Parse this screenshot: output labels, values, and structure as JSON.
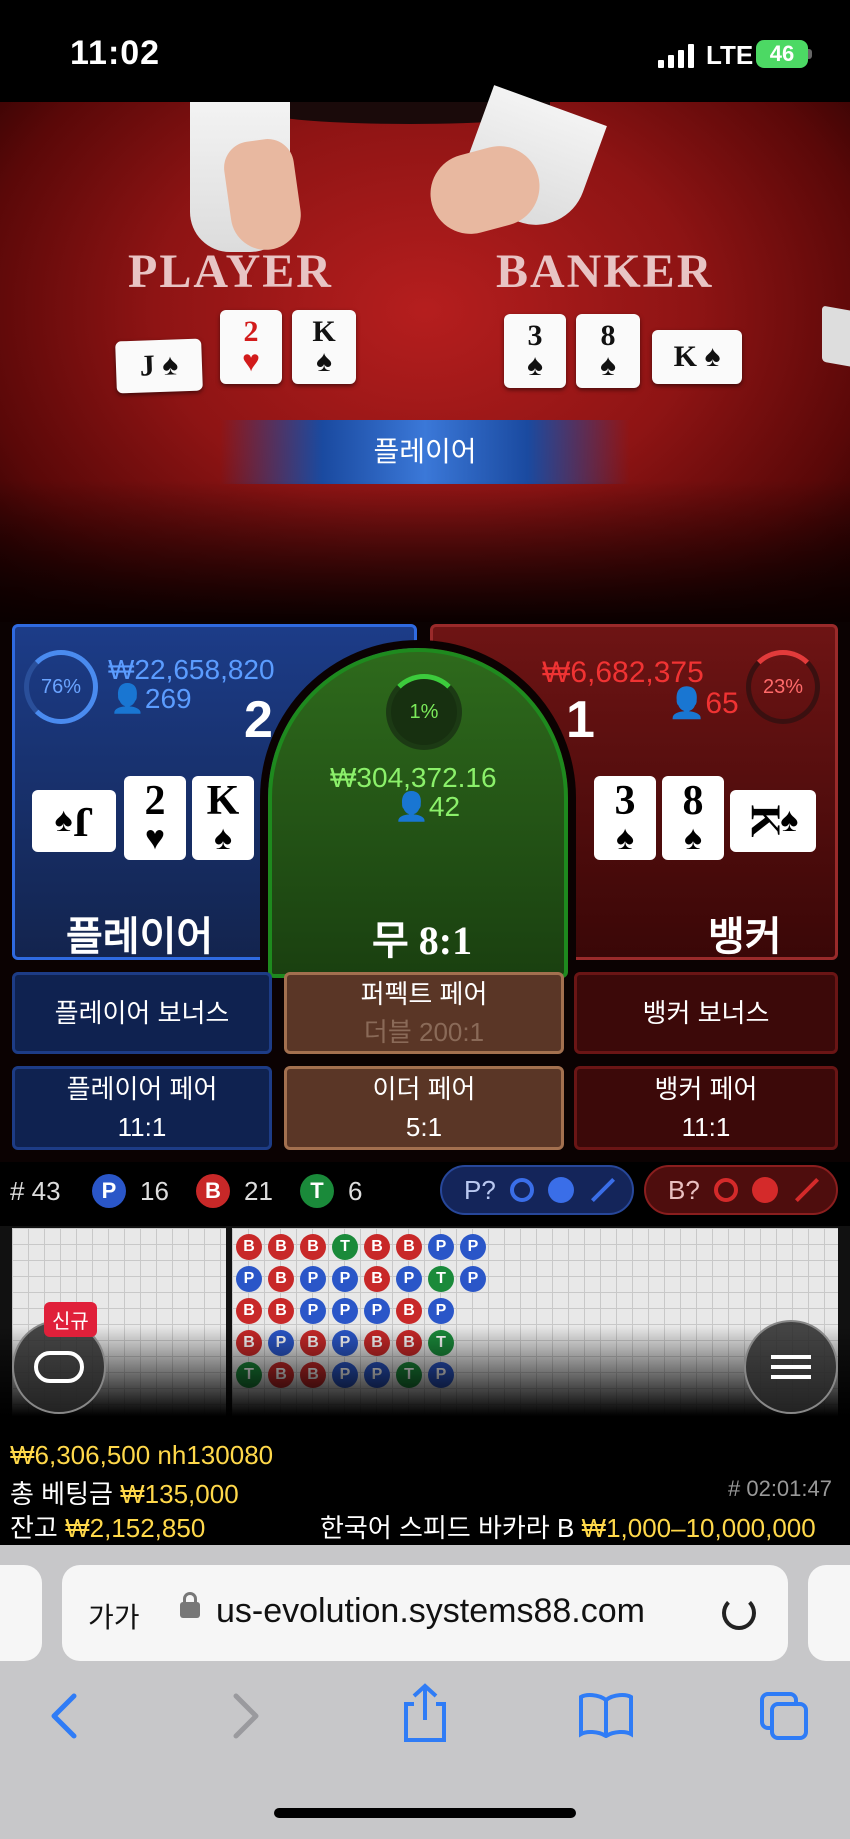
{
  "status_bar": {
    "time": "11:02",
    "network": "LTE",
    "battery": "46"
  },
  "video": {
    "player_label": "PLAYER",
    "banker_label": "BANKER",
    "banner": "플레이어",
    "player_cards": [
      {
        "rank": "J",
        "suit": "♠"
      },
      {
        "rank": "2",
        "suit": "♥"
      },
      {
        "rank": "K",
        "suit": "♠"
      }
    ],
    "banker_cards": [
      {
        "rank": "3",
        "suit": "♠"
      },
      {
        "rank": "8",
        "suit": "♠"
      },
      {
        "rank": "K",
        "suit": "♠"
      }
    ]
  },
  "bets": {
    "player": {
      "percent": "76%",
      "amount": "₩22,658,820",
      "players": "269",
      "score": "2",
      "label": "플레이어",
      "cards": [
        {
          "rank": "J",
          "suit": "♠"
        },
        {
          "rank": "2",
          "suit": "♥"
        },
        {
          "rank": "K",
          "suit": "♠"
        }
      ]
    },
    "tie": {
      "percent": "1%",
      "amount": "₩304,372.16",
      "players": "42",
      "label": "무 8:1"
    },
    "banker": {
      "percent": "23%",
      "amount": "₩6,682,375",
      "players": "65",
      "score": "1",
      "label": "뱅커",
      "cards": [
        {
          "rank": "3",
          "suit": "♠"
        },
        {
          "rank": "8",
          "suit": "♠"
        },
        {
          "rank": "K",
          "suit": "♠"
        }
      ]
    }
  },
  "side_bets": {
    "player_bonus": "플레이어 보너스",
    "perfect_pair": "퍼펙트 페어",
    "perfect_pair_sub": "더블 200:1",
    "banker_bonus": "뱅커 보너스",
    "player_pair": "플레이어 페어",
    "player_pair_odds": "11:1",
    "either_pair": "이더 페어",
    "either_pair_odds": "5:1",
    "banker_pair": "뱅커 페어",
    "banker_pair_odds": "11:1"
  },
  "stats": {
    "round": "# 43",
    "p_letter": "P",
    "p_count": "16",
    "b_letter": "B",
    "b_count": "21",
    "t_letter": "T",
    "t_count": "6",
    "player_predict": "P?",
    "banker_predict": "B?"
  },
  "roads": {
    "new_badge": "신규",
    "columns": [
      [
        "B",
        "P",
        "B",
        "B",
        "T"
      ],
      [
        "B",
        "B",
        "B",
        "P",
        "B"
      ],
      [
        "B",
        "P",
        "P",
        "B",
        "B"
      ],
      [
        "T",
        "P",
        "P",
        "P",
        "P"
      ],
      [
        "B",
        "B",
        "P",
        "B",
        "P"
      ],
      [
        "B",
        "P",
        "B",
        "B",
        "T"
      ],
      [
        "P",
        "T",
        "P",
        "T",
        "P"
      ],
      [
        "P",
        "P",
        "",
        "",
        ""
      ]
    ]
  },
  "info": {
    "win_line": "₩6,306,500 nh130080",
    "total_bet_label": "총 베팅금",
    "total_bet": "₩135,000",
    "game_time": "# 02:01:47",
    "balance_label": "잔고",
    "balance": "₩2,152,850",
    "table_name": "한국어 스피드 바카라 B",
    "limits": "₩1,000–10,000,000"
  },
  "browser": {
    "text_size": "가가",
    "url": "us-evolution.systems88.com"
  },
  "colors": {
    "player_blue": "#2f6ae0",
    "banker_red": "#9a2a2a",
    "tie_green": "#1e8a1e",
    "highlight_yellow": "#ffd84a",
    "ios_blue": "#2f7cf6"
  }
}
